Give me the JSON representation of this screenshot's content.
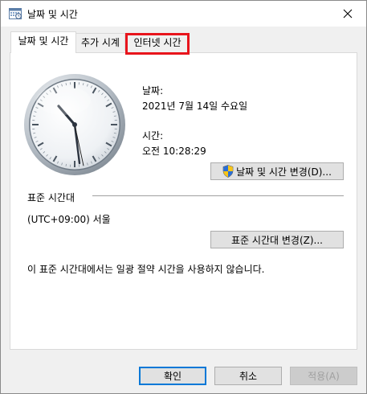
{
  "window": {
    "title": "날짜 및 시간",
    "close_glyph": "✕"
  },
  "tabs": [
    {
      "label": "날짜 및 시간",
      "active": true
    },
    {
      "label": "추가 시계",
      "active": false
    },
    {
      "label": "인터넷 시간",
      "active": false,
      "highlighted": true
    }
  ],
  "highlight_color": "#e8141c",
  "datetime": {
    "date_label": "날짜:",
    "date_value": "2021년 7월 14일 수요일",
    "time_label": "시간:",
    "time_value": "오전 10:28:29",
    "change_datetime_button": "날짜 및 시간 변경(D)..."
  },
  "timezone": {
    "heading": "표준 시간대",
    "value": "(UTC+09:00) 서울",
    "change_timezone_button": "표준 시간대 변경(Z)...",
    "dst_note": "이 표준 시간대에서는 일광 절약 시간을 사용하지 않습니다."
  },
  "footer": {
    "ok": "확인",
    "cancel": "취소",
    "apply": "적용(A)"
  },
  "icons": {
    "title": "datetime-app-icon",
    "close": "close-icon",
    "shield": "uac-shield-icon",
    "clock": "analog-clock"
  }
}
